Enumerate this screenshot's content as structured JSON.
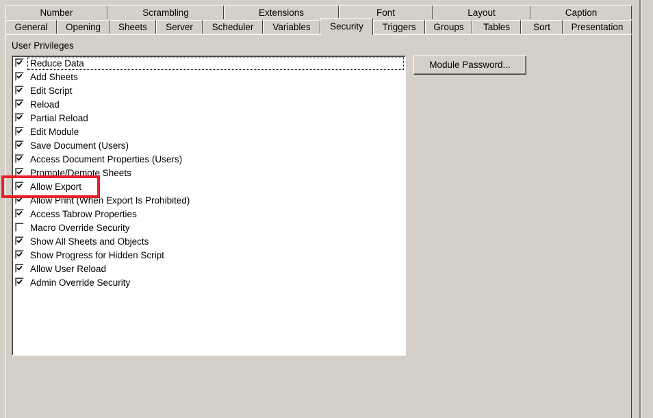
{
  "tabs": {
    "back_row": [
      "Number",
      "Scrambling",
      "Extensions",
      "Font",
      "Layout",
      "Caption"
    ],
    "front_row": [
      "General",
      "Opening",
      "Sheets",
      "Server",
      "Scheduler",
      "Variables",
      "Security",
      "Triggers",
      "Groups",
      "Tables",
      "Sort",
      "Presentation"
    ],
    "active": "Security"
  },
  "security": {
    "group_label": "User Privileges",
    "module_password_label": "Module Password...",
    "privileges": [
      {
        "label": "Reduce Data",
        "checked": true
      },
      {
        "label": "Add Sheets",
        "checked": true
      },
      {
        "label": "Edit Script",
        "checked": true
      },
      {
        "label": "Reload",
        "checked": true
      },
      {
        "label": "Partial Reload",
        "checked": true
      },
      {
        "label": "Edit Module",
        "checked": true
      },
      {
        "label": "Save Document (Users)",
        "checked": true
      },
      {
        "label": "Access Document Properties (Users)",
        "checked": true
      },
      {
        "label": "Promote/Demote Sheets",
        "checked": true
      },
      {
        "label": "Allow Export",
        "checked": true
      },
      {
        "label": "Allow Print (When Export Is Prohibited)",
        "checked": true
      },
      {
        "label": "Access Tabrow Properties",
        "checked": true
      },
      {
        "label": "Macro Override Security",
        "checked": false
      },
      {
        "label": "Show All Sheets and Objects",
        "checked": true
      },
      {
        "label": "Show Progress for Hidden Script",
        "checked": true
      },
      {
        "label": "Allow User Reload",
        "checked": true
      },
      {
        "label": "Admin Override Security",
        "checked": true
      }
    ]
  },
  "annotation": {
    "color": "#e8202a"
  }
}
